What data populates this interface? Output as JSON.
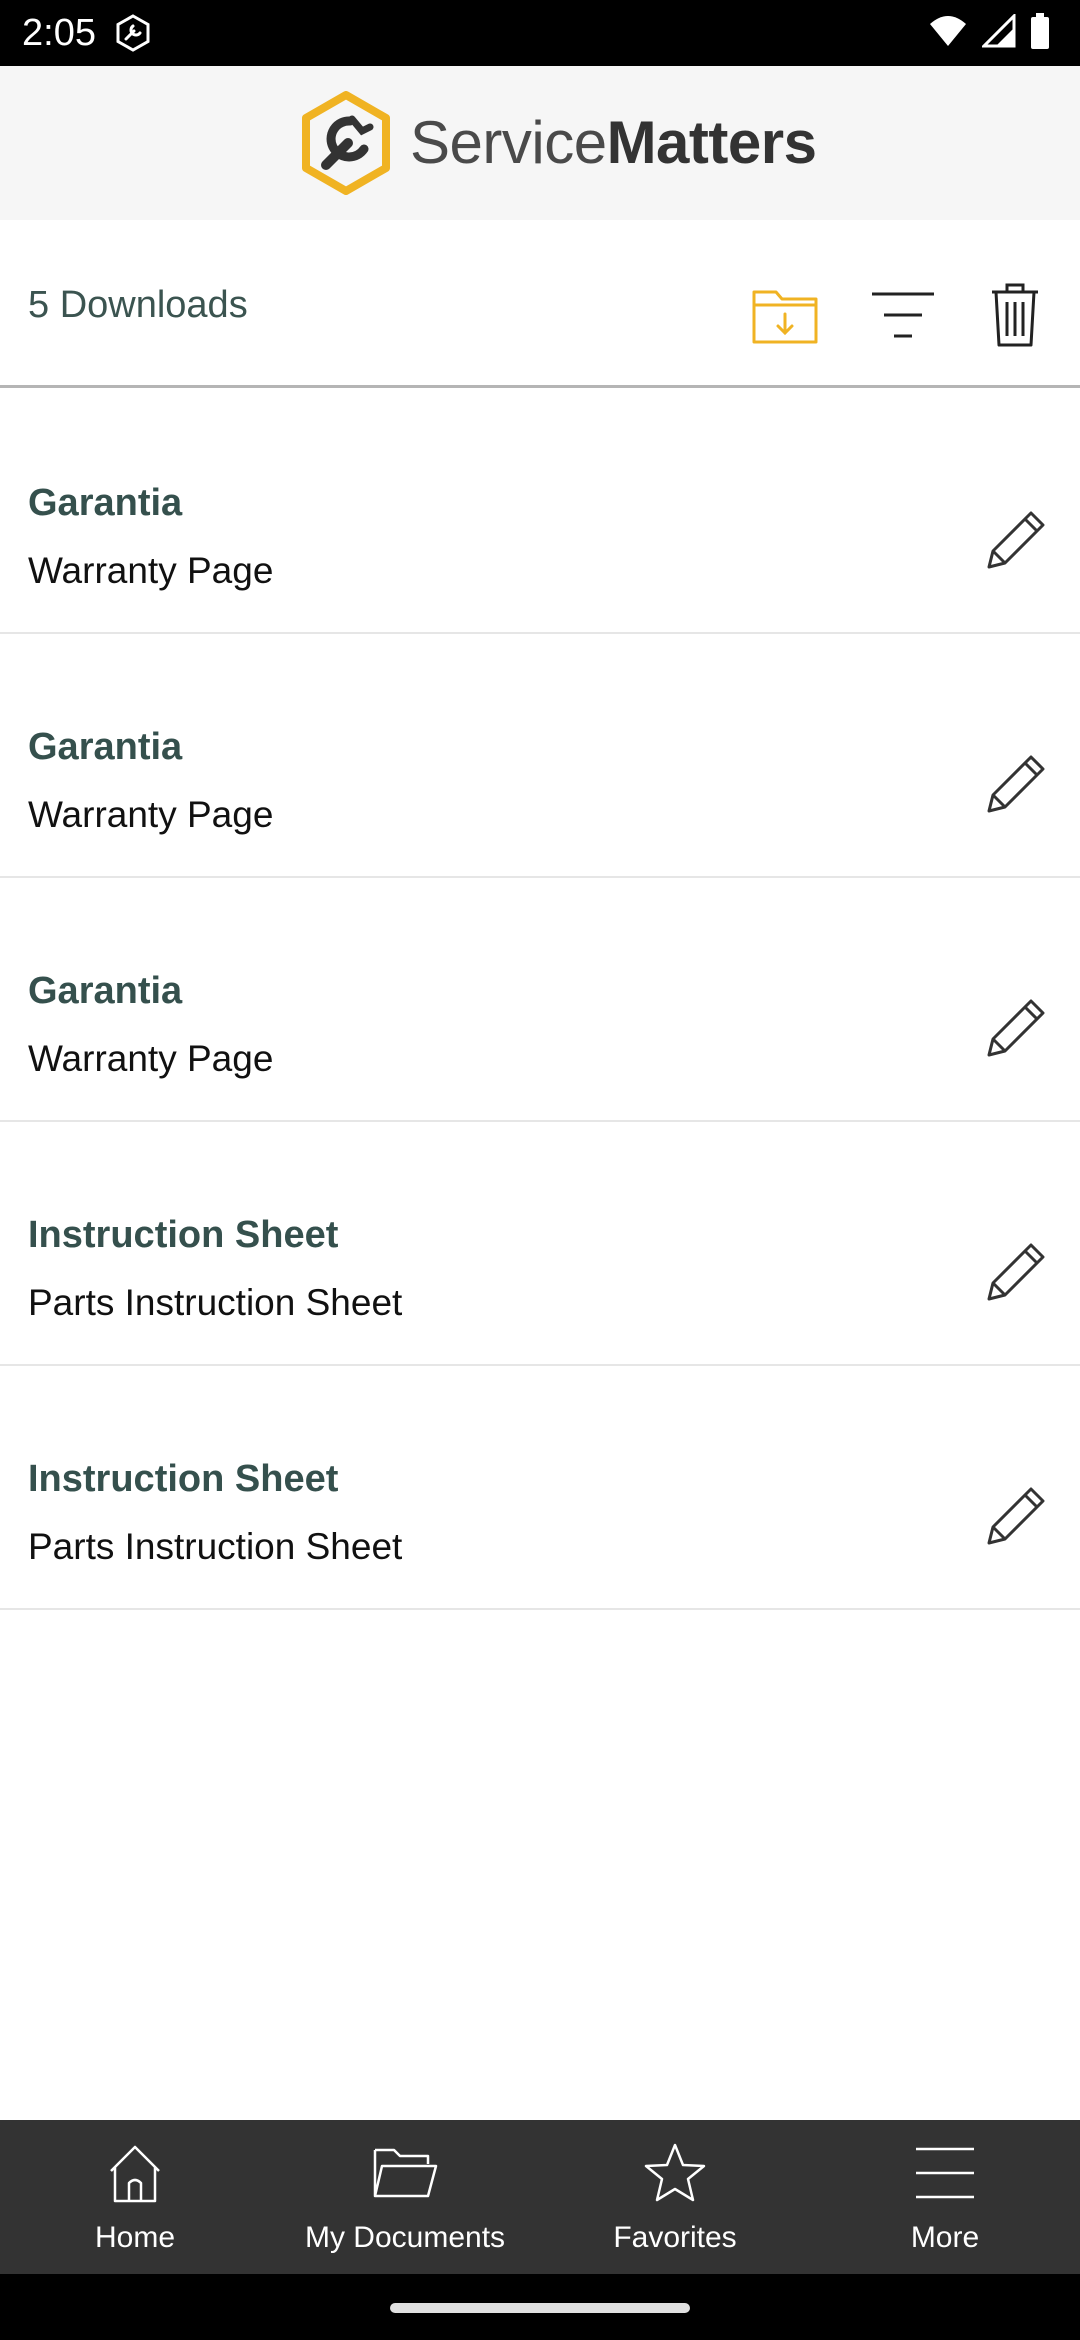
{
  "status_bar": {
    "time": "2:05",
    "icons": [
      "app-notification-icon",
      "wifi-icon",
      "signal-icon",
      "battery-icon"
    ]
  },
  "header": {
    "logo_icon": "wrench-hexagon-icon",
    "brand_light": "Service",
    "brand_bold": "Matters",
    "accent_color": "#F0B323"
  },
  "toolbar": {
    "downloads_label": "5 Downloads",
    "actions": [
      "folder-download-icon",
      "filter-icon",
      "trash-icon"
    ]
  },
  "documents": [
    {
      "title": "Garantia",
      "subtitle": "Warranty Page"
    },
    {
      "title": "Garantia",
      "subtitle": "Warranty Page"
    },
    {
      "title": "Garantia",
      "subtitle": "Warranty Page"
    },
    {
      "title": "Instruction Sheet",
      "subtitle": "Parts Instruction Sheet"
    },
    {
      "title": "Instruction Sheet",
      "subtitle": "Parts Instruction Sheet"
    }
  ],
  "bottom_nav": {
    "items": [
      {
        "label": "Home",
        "icon": "home-icon"
      },
      {
        "label": "My Documents",
        "icon": "folder-icon"
      },
      {
        "label": "Favorites",
        "icon": "star-icon"
      },
      {
        "label": "More",
        "icon": "menu-icon"
      }
    ]
  },
  "colors": {
    "title_text": "#35504D",
    "nav_background": "#333333",
    "header_background": "#F6F6F6"
  }
}
